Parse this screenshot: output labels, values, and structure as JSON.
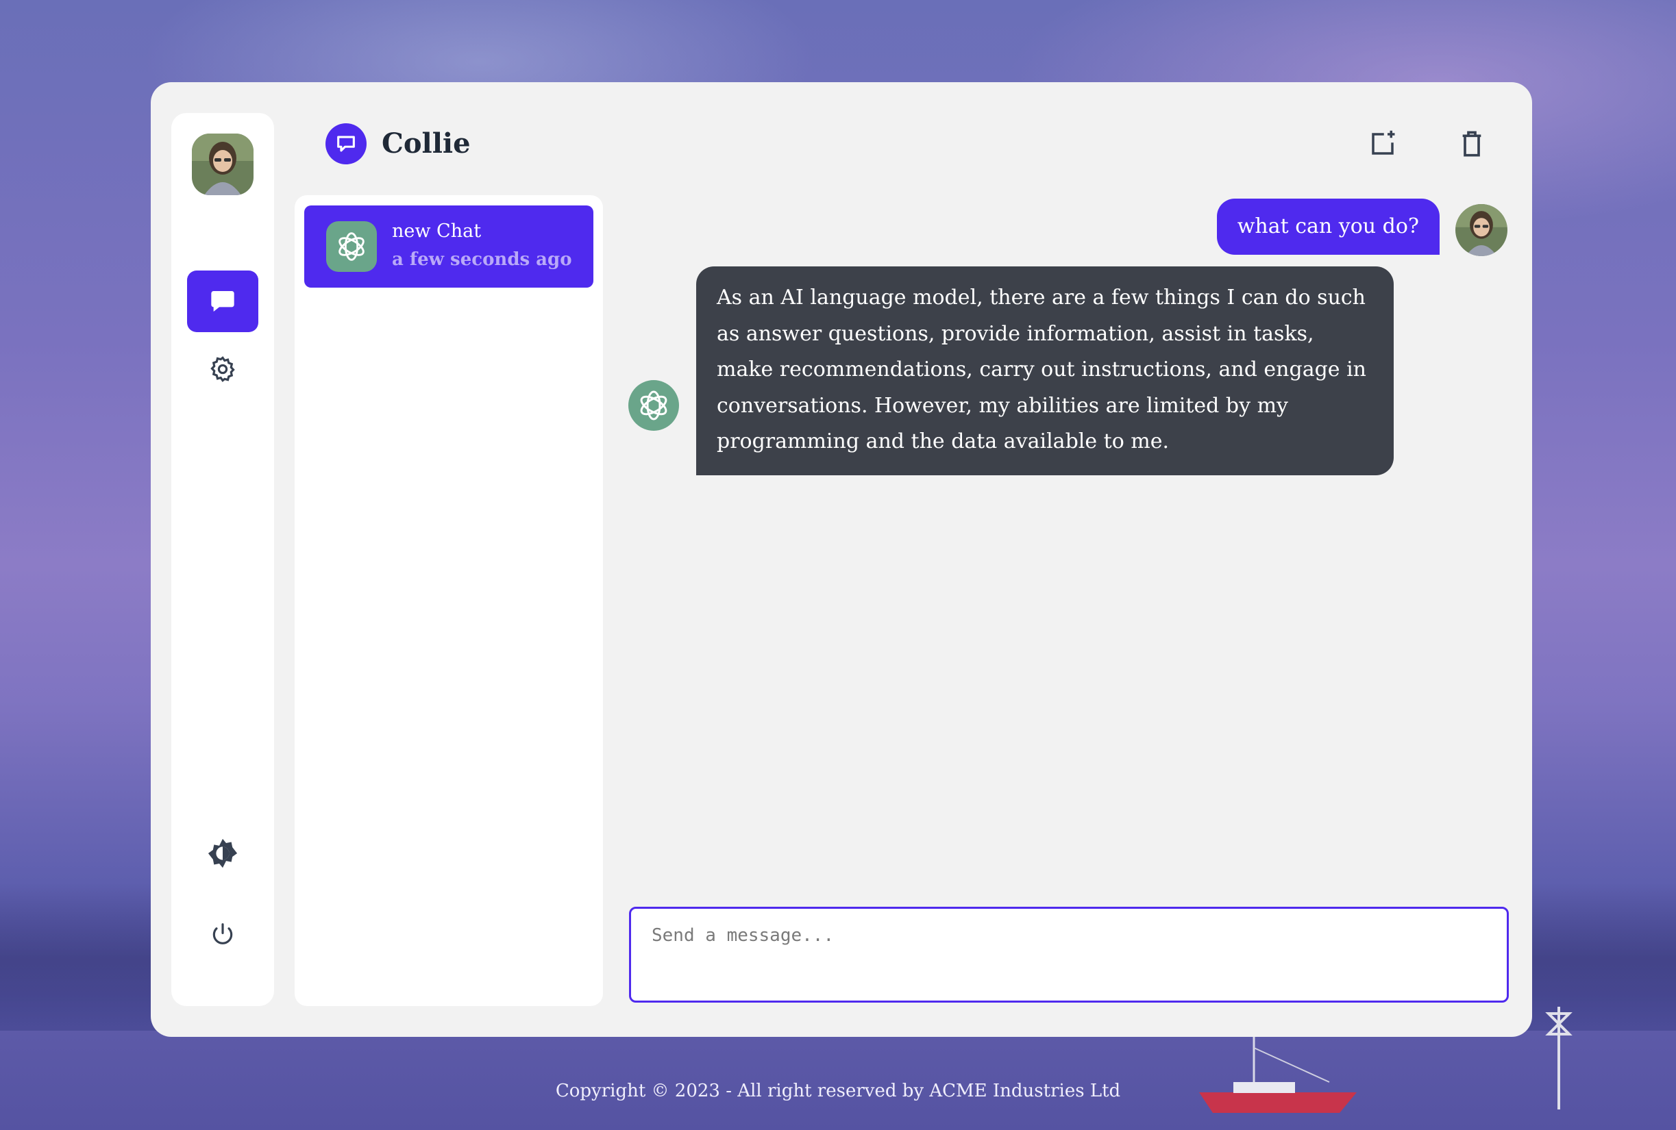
{
  "app": {
    "title": "Collie"
  },
  "header": {
    "new_chat_icon": "new-chat-icon",
    "delete_icon": "trash-icon"
  },
  "sidebar": {
    "items": [
      {
        "name": "chats",
        "icon": "chat-icon",
        "active": true
      },
      {
        "name": "settings",
        "icon": "gear-icon",
        "active": false
      },
      {
        "name": "theme",
        "icon": "contrast-icon",
        "active": false
      },
      {
        "name": "logout",
        "icon": "power-icon",
        "active": false
      }
    ]
  },
  "chat_list": [
    {
      "title": "new Chat",
      "time": "a few seconds ago"
    }
  ],
  "messages": {
    "user": "what can you do?",
    "assistant": "As an AI language model, there are a few things I can do such as answer questions, provide information, assist in tasks, make recommendations, carry out instructions, and engage in conversations. However, my abilities are limited by my programming and the data available to me."
  },
  "composer": {
    "placeholder": "Send a message..."
  },
  "footer": {
    "text": "Copyright © 2023 - All right reserved by ACME Industries Ltd"
  },
  "colors": {
    "accent": "#4f2aee",
    "assistant_bubble": "#3d414a",
    "panel": "#f2f2f2",
    "ai_avatar": "#6aa58a"
  }
}
